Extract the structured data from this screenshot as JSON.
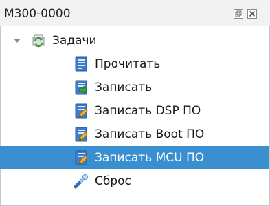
{
  "panel": {
    "title": "М300-0000",
    "controls": {
      "float_icon": "float-window-icon",
      "close_icon": "close-icon"
    }
  },
  "tree": {
    "root": {
      "label": "Задачи",
      "icon": "tasks-sync-icon",
      "expanded": true
    },
    "items": [
      {
        "label": "Прочитать",
        "icon": "document-read-icon",
        "selected": false
      },
      {
        "label": "Записать",
        "icon": "document-write-icon",
        "selected": false
      },
      {
        "label": "Записать DSP ПО",
        "icon": "document-edit-icon",
        "selected": false
      },
      {
        "label": "Записать Boot ПО",
        "icon": "document-edit-icon",
        "selected": false
      },
      {
        "label": "Записать MCU ПО",
        "icon": "document-edit-icon",
        "selected": true
      },
      {
        "label": "Сброс",
        "icon": "reset-tool-icon",
        "selected": false
      }
    ]
  },
  "colors": {
    "selection": "#3a8fd1",
    "titlebar": "#f2f2f2"
  }
}
